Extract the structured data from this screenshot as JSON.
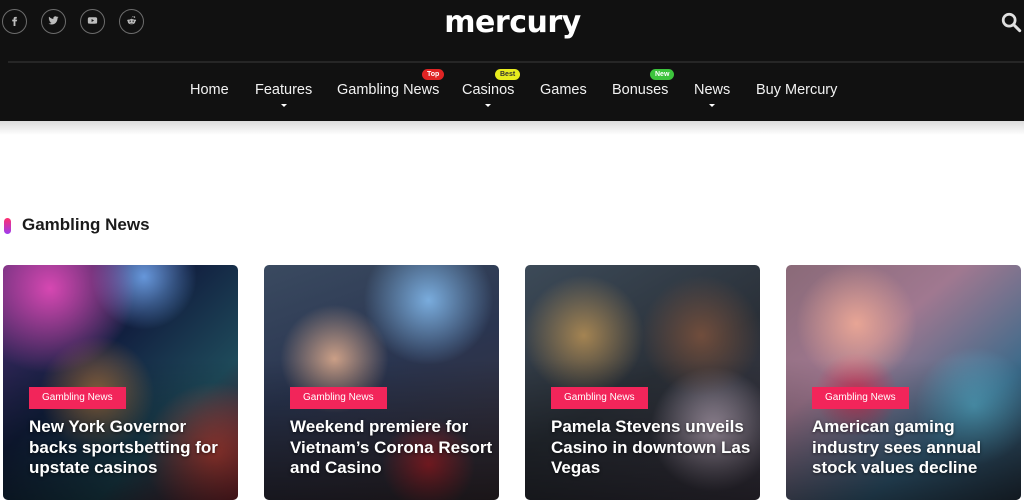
{
  "header": {
    "logo": "mercury",
    "socials": [
      {
        "name": "facebook-icon",
        "label": "Facebook"
      },
      {
        "name": "twitter-icon",
        "label": "Twitter"
      },
      {
        "name": "youtube-icon",
        "label": "YouTube"
      },
      {
        "name": "reddit-icon",
        "label": "Reddit"
      }
    ],
    "search_icon": "search-icon"
  },
  "nav": {
    "items": [
      {
        "label": "Home",
        "dropdown": false
      },
      {
        "label": "Features",
        "dropdown": true
      },
      {
        "label": "Gambling News",
        "dropdown": false,
        "badge": "Top",
        "badge_color": "#e02424"
      },
      {
        "label": "Casinos",
        "dropdown": true,
        "badge": "Best",
        "badge_color": "#e8ec1e"
      },
      {
        "label": "Games",
        "dropdown": false
      },
      {
        "label": "Bonuses",
        "dropdown": false,
        "badge": "New",
        "badge_color": "#3cc43c"
      },
      {
        "label": "News",
        "dropdown": true
      },
      {
        "label": "Buy Mercury",
        "dropdown": false
      }
    ]
  },
  "section": {
    "title": "Gambling News",
    "accent_color": "#f2255a",
    "cards": [
      {
        "tag": "Gambling News",
        "title": "New York Governor backs sportsbetting for upstate casinos"
      },
      {
        "tag": "Gambling News",
        "title": "Weekend premiere for Vietnam’s Corona Resort and Casino"
      },
      {
        "tag": "Gambling News",
        "title": "Pamela Stevens unveils Casino in downtown Las Vegas"
      },
      {
        "tag": "Gambling News",
        "title": "American gaming industry sees annual stock values decline"
      }
    ]
  }
}
